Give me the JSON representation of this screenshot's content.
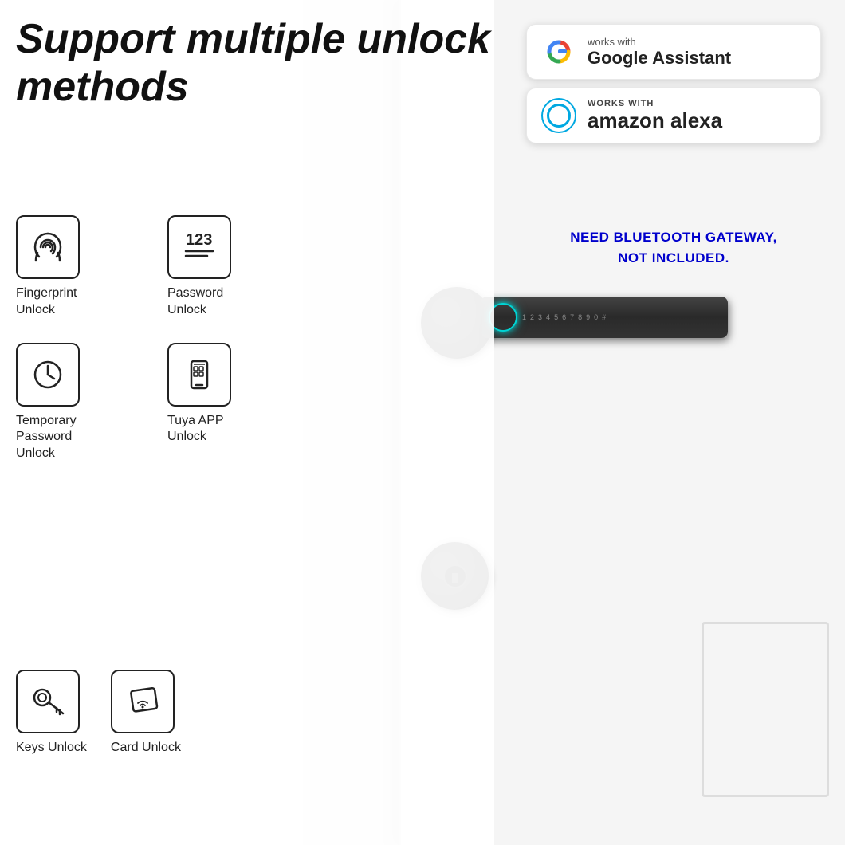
{
  "heading": {
    "title": "Support multiple unlock methods"
  },
  "badges": {
    "google": {
      "prefix": "works with",
      "name": "Google Assistant"
    },
    "alexa": {
      "works_with": "WORKS WITH",
      "name": "amazon alexa"
    }
  },
  "bluetooth_notice": {
    "line1": "NEED BLUETOOTH GATEWAY,",
    "line2": "NOT INCLUDED."
  },
  "unlock_methods": [
    {
      "id": "fingerprint",
      "label": "Fingerprint\nUnlock",
      "icon": "fingerprint"
    },
    {
      "id": "password",
      "label": "Password\nUnlock",
      "icon": "password"
    },
    {
      "id": "temporary",
      "label": "Temporary\nPassword\nUnlock",
      "icon": "clock"
    },
    {
      "id": "tuya",
      "label": "Tuya APP\nUnlock",
      "icon": "phone"
    },
    {
      "id": "keys",
      "label": "Keys Unlock",
      "icon": "key"
    },
    {
      "id": "card",
      "label": "Card  Unlock",
      "icon": "card"
    }
  ],
  "colors": {
    "heading_color": "#111111",
    "bluetooth_color": "#0000cc",
    "badge_border": "#e8e8e8",
    "icon_stroke": "#222222"
  }
}
